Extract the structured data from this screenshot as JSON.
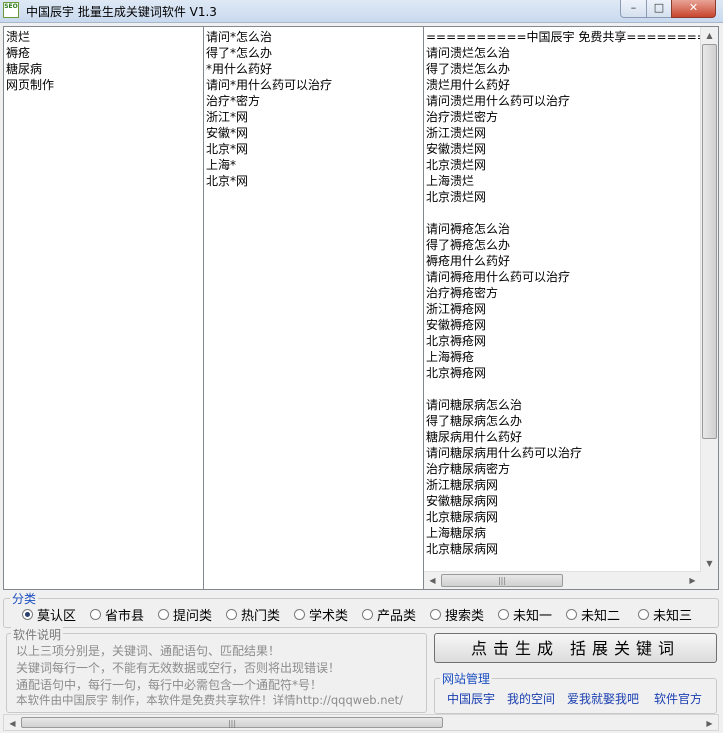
{
  "window": {
    "title": "中国辰宇 批量生成关键词软件 V1.3",
    "icon_text": "SEO",
    "minimize": "–",
    "maximize": "□",
    "close": "✕"
  },
  "keywords_panel": {
    "lines": [
      "溃烂",
      "褥疮",
      "糖尿病",
      "网页制作"
    ]
  },
  "templates_panel": {
    "lines": [
      "请问*怎么治",
      "得了*怎么办",
      "*用什么药好",
      "请问*用什么药可以治疗",
      "治疗*密方",
      "浙江*网",
      "安徽*网",
      "北京*网",
      "上海*",
      "北京*网"
    ]
  },
  "results_panel": {
    "lines": [
      "==========中国辰宇 免费共享====================",
      "请问溃烂怎么治",
      "得了溃烂怎么办",
      "溃烂用什么药好",
      "请问溃烂用什么药可以治疗",
      "治疗溃烂密方",
      "浙江溃烂网",
      "安徽溃烂网",
      "北京溃烂网",
      "上海溃烂",
      "北京溃烂网",
      "",
      "请问褥疮怎么治",
      "得了褥疮怎么办",
      "褥疮用什么药好",
      "请问褥疮用什么药可以治疗",
      "治疗褥疮密方",
      "浙江褥疮网",
      "安徽褥疮网",
      "北京褥疮网",
      "上海褥疮",
      "北京褥疮网",
      "",
      "请问糖尿病怎么治",
      "得了糖尿病怎么办",
      "糖尿病用什么药好",
      "请问糖尿病用什么药可以治疗",
      "治疗糖尿病密方",
      "浙江糖尿病网",
      "安徽糖尿病网",
      "北京糖尿病网",
      "上海糖尿病",
      "北京糖尿病网"
    ]
  },
  "category": {
    "legend": "分类",
    "options": [
      "莫认区",
      "省市县",
      "提问类",
      "热门类",
      "学术类",
      "产品类",
      "搜索类",
      "未知一",
      "未知二",
      "未知三"
    ],
    "selected": "莫认区"
  },
  "description": {
    "legend": "软件说明",
    "lines": [
      "以上三项分别是，关键词、通配语句、匹配结果！",
      "关键词每行一个，不能有无效数据或空行，否则将出现错误！",
      "通配语句中，每行一句，每行中必需包含一个通配符*号！",
      "本软件由中国辰宇 制作，本软件是免费共享软件！详情http://qqqweb.net/"
    ]
  },
  "generate_button": "点击生成  括展关键词",
  "site_management": {
    "legend": "网站管理",
    "links": [
      "中国辰宇",
      "我的空间",
      "爱我就娶我吧",
      "软件官方"
    ]
  },
  "colors": {
    "legend_blue": "#1a4ec0",
    "link_blue": "#1a3fb0",
    "description_gray": "#8c8c8c",
    "window_bg": "#f0f0f0"
  }
}
